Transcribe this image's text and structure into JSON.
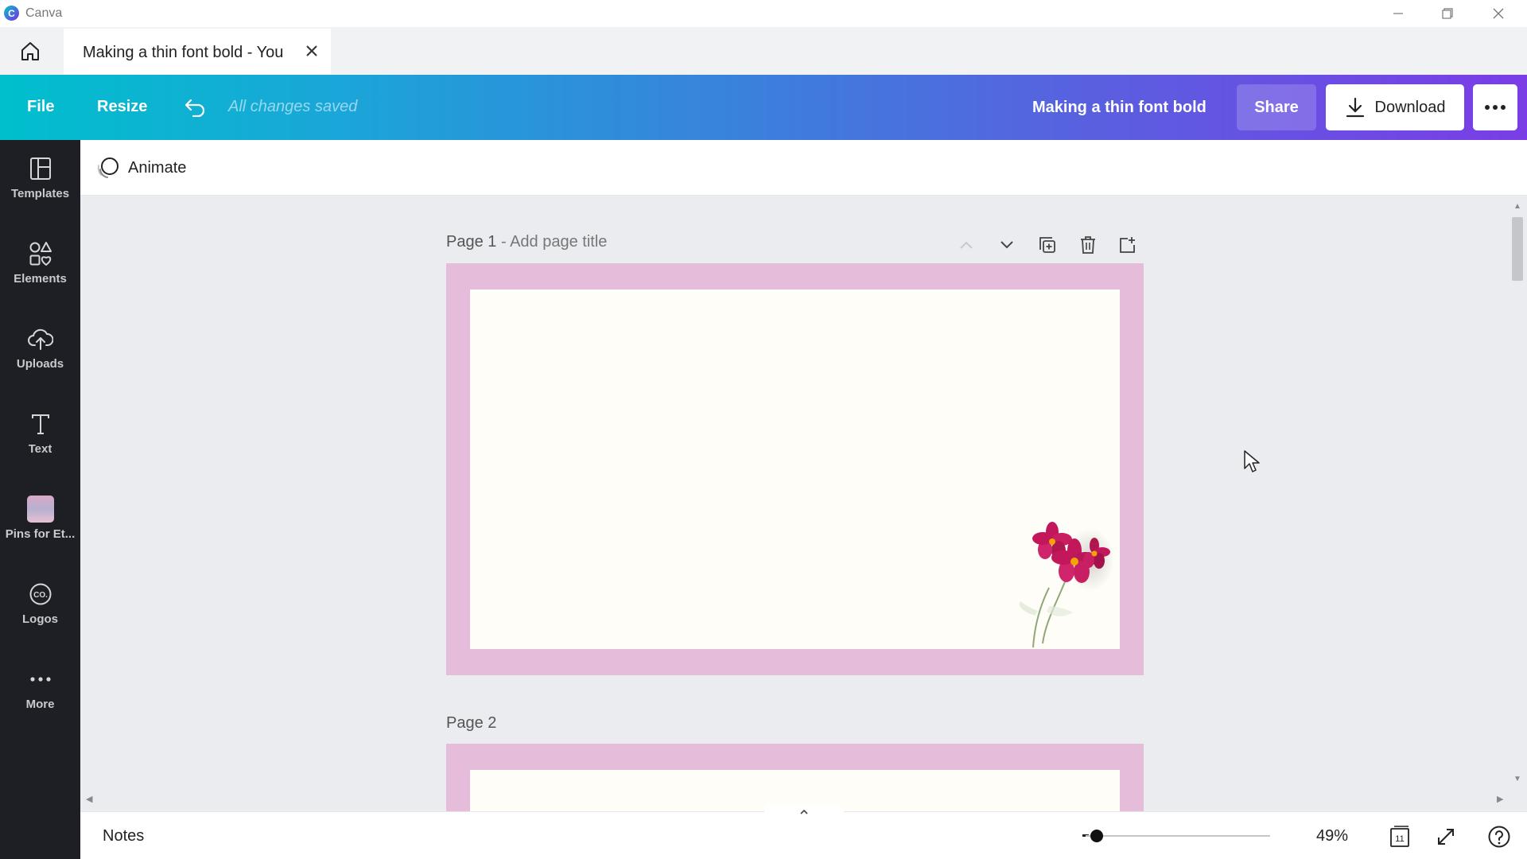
{
  "window": {
    "app_name": "Canva"
  },
  "tab": {
    "title": "Making a thin font bold - You"
  },
  "toolbar": {
    "file_label": "File",
    "resize_label": "Resize",
    "saved_status": "All changes saved",
    "document_title": "Making a thin font bold",
    "share_label": "Share",
    "download_label": "Download"
  },
  "sidebar": {
    "items": [
      {
        "label": "Templates",
        "icon": "templates-icon"
      },
      {
        "label": "Elements",
        "icon": "elements-icon"
      },
      {
        "label": "Uploads",
        "icon": "upload-cloud-icon"
      },
      {
        "label": "Text",
        "icon": "text-icon"
      },
      {
        "label": "Pins for Et...",
        "icon": "folder-thumbnail-icon"
      },
      {
        "label": "Logos",
        "icon": "logo-icon"
      },
      {
        "label": "More",
        "icon": "more-icon"
      }
    ]
  },
  "subbar": {
    "animate_label": "Animate"
  },
  "pages": [
    {
      "label": "Page 1",
      "title_placeholder": "- Add page title"
    },
    {
      "label": "Page 2"
    }
  ],
  "bottombar": {
    "notes_label": "Notes",
    "zoom": "49%",
    "zoom_fraction": 0.06,
    "page_count": "11"
  },
  "colors": {
    "toolbar_gradient_start": "#00bfcc",
    "toolbar_gradient_end": "#7a3de6",
    "sidebar_bg": "#1d1f24",
    "page_border": "#e6bcdb",
    "page_fill": "#fffdf7"
  }
}
